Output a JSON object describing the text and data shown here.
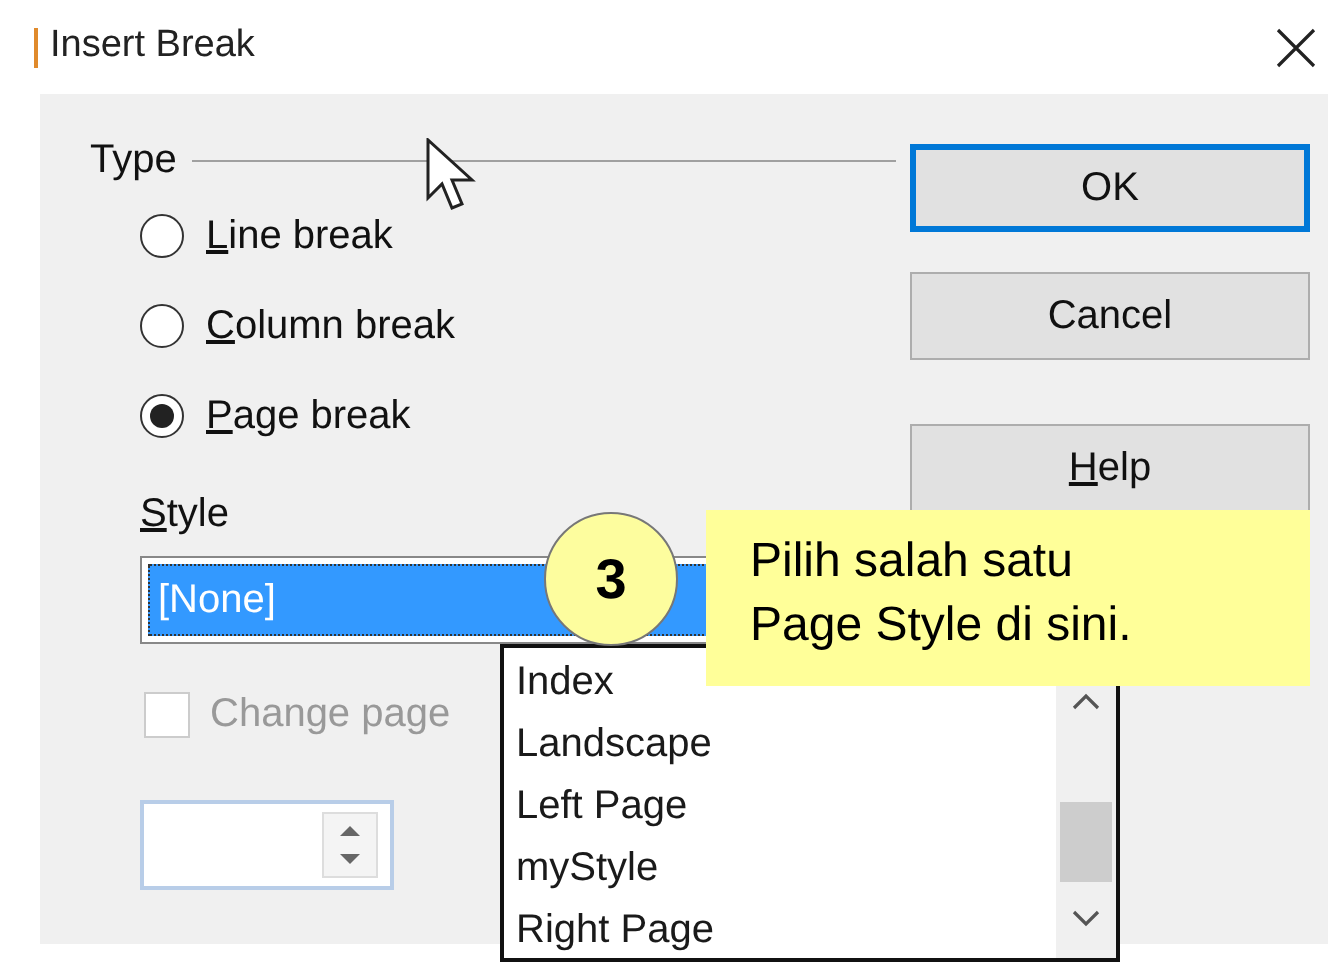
{
  "window": {
    "title": "Insert Break"
  },
  "type_group": {
    "label": "Type",
    "options": [
      {
        "key": "L",
        "rest": "ine break",
        "selected": false
      },
      {
        "key": "C",
        "rest": "olumn break",
        "selected": false
      },
      {
        "key": "P",
        "rest": "age break",
        "selected": true
      }
    ]
  },
  "style": {
    "key": "S",
    "rest": "tyle",
    "value": "[None]",
    "open": true,
    "options": [
      "Index",
      "Landscape",
      "Left Page",
      "myStyle",
      "Right Page"
    ]
  },
  "change_page": {
    "label": "Change page",
    "checked": false,
    "disabled": true
  },
  "buttons": [
    {
      "label": "OK",
      "default": true
    },
    {
      "label": "Cancel",
      "default": false
    },
    {
      "key": "H",
      "rest": "elp",
      "default": false
    }
  ],
  "callout": {
    "step": "3",
    "lines": [
      "Pilih salah satu",
      "Page Style di sini."
    ]
  }
}
